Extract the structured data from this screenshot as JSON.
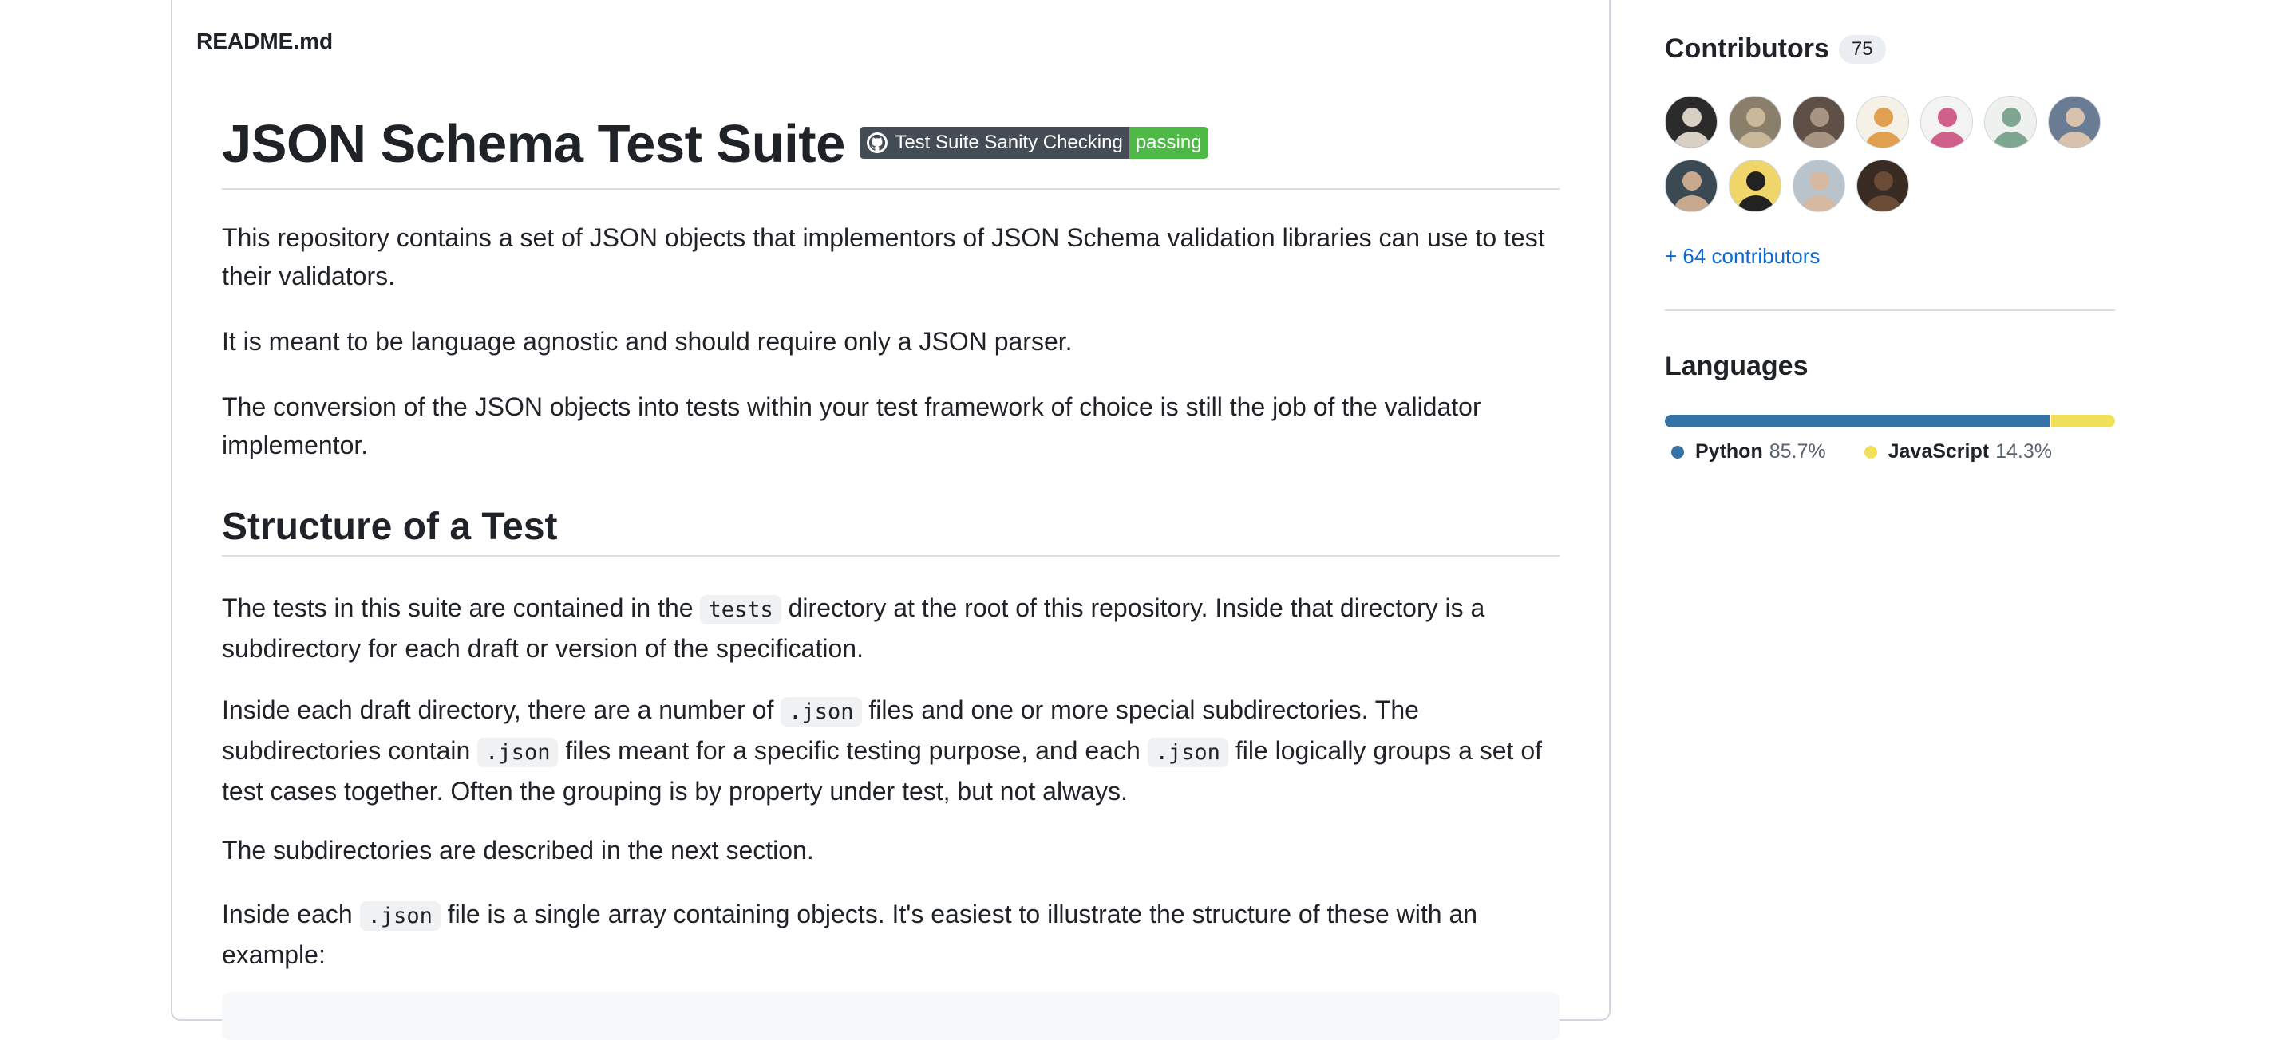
{
  "readme": {
    "filename": "README.md",
    "title": "JSON Schema Test Suite",
    "badge": {
      "label": "Test Suite Sanity Checking",
      "status": "passing",
      "status_color": "#4fb948"
    },
    "intro": [
      "This repository contains a set of JSON objects that implementors of JSON Schema validation libraries can use to test their validators.",
      "It is meant to be language agnostic and should require only a JSON parser.",
      "The conversion of the JSON objects into tests within your test framework of choice is still the job of the validator implementor."
    ],
    "section_heading": "Structure of a Test",
    "p_tests": {
      "before": "The tests in this suite are contained in the ",
      "code": "tests",
      "after": " directory at the root of this repository. Inside that directory is a subdirectory for each draft or version of the specification."
    },
    "p_draft": {
      "t1": "Inside each draft directory, there are a number of ",
      "c1": ".json",
      "t2": " files and one or more special subdirectories. The subdirectories contain ",
      "c2": ".json",
      "t3": " files meant for a specific testing purpose, and each ",
      "c3": ".json",
      "t4": " file logically groups a set of test cases together. Often the grouping is by property under test, but not always."
    },
    "p_subdirs": "The subdirectories are described in the next section.",
    "p_array": {
      "before": "Inside each ",
      "code": ".json",
      "after": " file is a single array containing objects. It's easiest to illustrate the structure of these with an example:"
    }
  },
  "sidebar": {
    "contributors": {
      "heading": "Contributors",
      "count": "75",
      "more": "+ 64 contributors",
      "avatars": [
        {
          "name": "avatar-1",
          "bg": "#2b2b2b",
          "fg": "#d9d0c4"
        },
        {
          "name": "avatar-2",
          "bg": "#8a7f6a",
          "fg": "#c9b89a"
        },
        {
          "name": "avatar-3",
          "bg": "#5e5047",
          "fg": "#a89482"
        },
        {
          "name": "avatar-4",
          "bg": "#f6f1e6",
          "fg": "#e0a050"
        },
        {
          "name": "avatar-5",
          "bg": "#f3f3f3",
          "fg": "#d0608a"
        },
        {
          "name": "avatar-6",
          "bg": "#eef1ee",
          "fg": "#7fa690"
        },
        {
          "name": "avatar-7",
          "bg": "#6a7b94",
          "fg": "#d8c2ad"
        },
        {
          "name": "avatar-8",
          "bg": "#3b4a52",
          "fg": "#c8a98e"
        },
        {
          "name": "avatar-9",
          "bg": "#f0d66a",
          "fg": "#222222"
        },
        {
          "name": "avatar-10",
          "bg": "#b9c3cc",
          "fg": "#d6b9a0"
        },
        {
          "name": "avatar-11",
          "bg": "#3a2b22",
          "fg": "#6a4b36"
        }
      ]
    },
    "languages": {
      "heading": "Languages",
      "items": [
        {
          "name": "Python",
          "percent": "85.7%",
          "share": 85.7,
          "color": "#3572A5"
        },
        {
          "name": "JavaScript",
          "percent": "14.3%",
          "share": 14.3,
          "color": "#f1e05a"
        }
      ]
    }
  }
}
